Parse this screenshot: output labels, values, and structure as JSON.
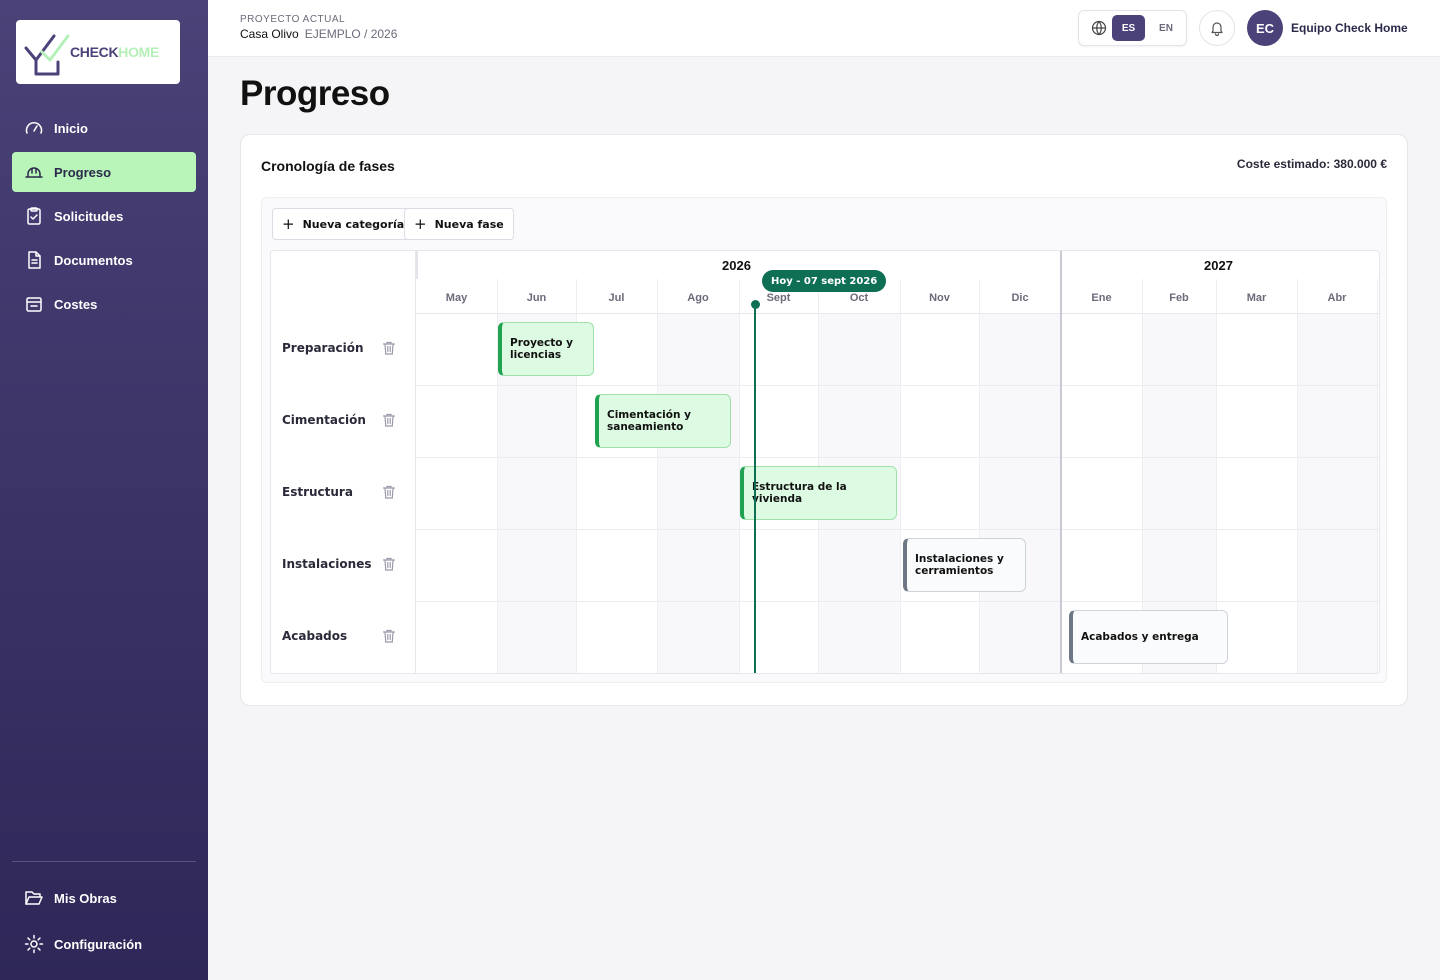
{
  "app": {
    "logo": {
      "part1": "CHECK",
      "part2": "HOME"
    },
    "colors": {
      "brand": "#4a4278",
      "active_nav": "#b9f4b9",
      "today": "#0e6f55",
      "bar_green": "#1fa350",
      "bar_grey": "#6e7786"
    }
  },
  "sidebar": {
    "items": [
      {
        "label": "Inicio",
        "icon": "gauge-icon"
      },
      {
        "label": "Progreso",
        "icon": "hardhat-icon",
        "active": true
      },
      {
        "label": "Solicitudes",
        "icon": "clipboard-check-icon"
      },
      {
        "label": "Documentos",
        "icon": "document-icon"
      },
      {
        "label": "Costes",
        "icon": "receipt-icon"
      }
    ],
    "bottom": [
      {
        "label": "Mis Obras",
        "icon": "folder-open-icon"
      },
      {
        "label": "Configuración",
        "icon": "gear-icon"
      }
    ]
  },
  "header": {
    "project_label": "PROYECTO ACTUAL",
    "project_name": "Casa Olivo",
    "project_sub": "EJEMPLO / 2026",
    "lang_es": "ES",
    "lang_en": "EN",
    "avatar_initials": "EC",
    "user_name": "Equipo Check Home"
  },
  "page": {
    "title": "Progreso",
    "card_title": "Cronología de fases",
    "cost": "Coste estimado: 380.000 €",
    "btn_new_category": "Nueva categoría",
    "btn_new_phase": "Nueva fase"
  },
  "timeline": {
    "years": [
      {
        "label": "2026"
      },
      {
        "label": "2027"
      }
    ],
    "months": [
      "May",
      "Jun",
      "Jul",
      "Ago",
      "Sept",
      "Oct",
      "Nov",
      "Dic",
      "Ene",
      "Feb",
      "Mar",
      "Abr"
    ],
    "today_label": "Hoy - 07 sept 2026",
    "rows": [
      {
        "category": "Preparación",
        "phase": "Proyecto y licencias",
        "status": "green"
      },
      {
        "category": "Cimentación",
        "phase": "Cimentación y saneamiento",
        "status": "green"
      },
      {
        "category": "Estructura",
        "phase": "Estructura de la vivienda",
        "status": "green"
      },
      {
        "category": "Instalaciones",
        "phase": "Instalaciones y cerramientos",
        "status": "grey"
      },
      {
        "category": "Acabados",
        "phase": "Acabados y entrega",
        "status": "grey"
      }
    ]
  }
}
